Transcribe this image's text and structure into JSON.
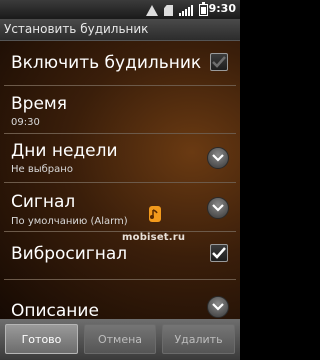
{
  "status_bar": {
    "time": "9:30",
    "icons": [
      "warning-icon",
      "sd-card-icon",
      "signal-icon",
      "battery-icon"
    ]
  },
  "title_bar": {
    "title": "Установить будильник"
  },
  "settings": {
    "enable_alarm": {
      "title": "Включить будильник",
      "checked": false
    },
    "time": {
      "title": "Время",
      "value": "09:30"
    },
    "days": {
      "title": "Дни недели",
      "value": "Не выбрано"
    },
    "ringtone": {
      "title": "Сигнал",
      "value": "По умолчанию (Alarm)"
    },
    "vibrate": {
      "title": "Вибросигнал",
      "checked": true
    },
    "description": {
      "title": "Описание"
    }
  },
  "watermark": "mobiset.ru",
  "buttons": {
    "done": "Готово",
    "cancel": "Отмена",
    "delete": "Удалить"
  },
  "colors": {
    "background": "#3a1e0a",
    "accent_logo": "#f29a1c"
  }
}
